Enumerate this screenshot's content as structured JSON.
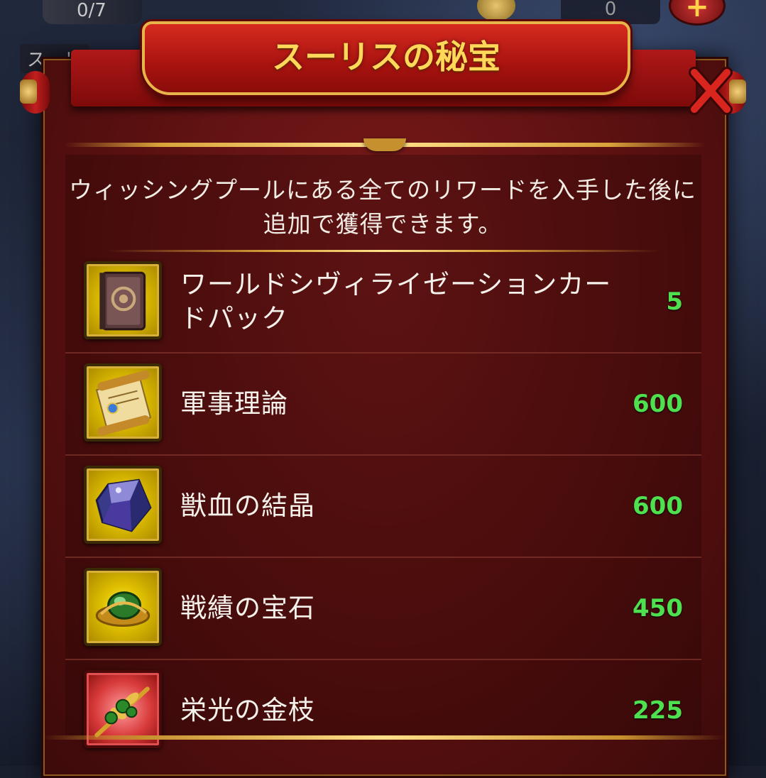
{
  "background": {
    "top_counter": "0/7",
    "top_value": "0",
    "sub_label": "スーリ",
    "plus_label": "+"
  },
  "header": {
    "title": "スーリスの秘宝"
  },
  "description": "ウィッシングプールにある全てのリワードを入手した後に追加で獲得できます。",
  "rewards": [
    {
      "name": "ワールドシヴィライゼーションカードパック",
      "count": "5",
      "icon": "card-pack-icon",
      "frame": "gold"
    },
    {
      "name": "軍事理論",
      "count": "600",
      "icon": "scroll-icon",
      "frame": "gold"
    },
    {
      "name": "獣血の結晶",
      "count": "600",
      "icon": "crystal-icon",
      "frame": "gold"
    },
    {
      "name": "戦績の宝石",
      "count": "450",
      "icon": "gem-icon",
      "frame": "gold"
    },
    {
      "name": "栄光の金枝",
      "count": "225",
      "icon": "golden-branch-icon",
      "frame": "red"
    }
  ],
  "colors": {
    "count_green": "#4fe04f",
    "title_gold": "#ffd85a",
    "panel_red": "#5a1010"
  }
}
